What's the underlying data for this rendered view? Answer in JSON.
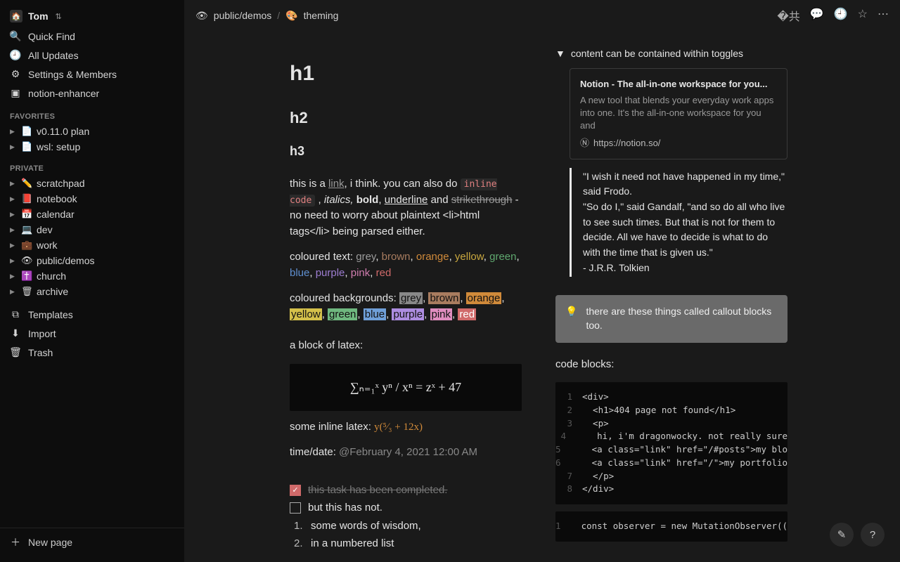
{
  "workspace": {
    "name": "Tom",
    "avatar_emoji": "🏠"
  },
  "sidebar": {
    "quick_find": "Quick Find",
    "all_updates": "All Updates",
    "settings": "Settings & Members",
    "enhancer": "notion-enhancer",
    "favorites_label": "FAVORITES",
    "favorites": [
      {
        "icon": "📄",
        "label": "v0.11.0 plan"
      },
      {
        "icon": "📄",
        "label": "wsl: setup"
      }
    ],
    "private_label": "PRIVATE",
    "private": [
      {
        "icon": "✏️",
        "label": "scratchpad"
      },
      {
        "icon": "📕",
        "label": "notebook"
      },
      {
        "icon": "📅",
        "label": "calendar"
      },
      {
        "icon": "💻",
        "label": "dev"
      },
      {
        "icon": "💼",
        "label": "work"
      },
      {
        "icon": "👁",
        "label": "public/demos"
      },
      {
        "icon": "✝️",
        "label": "church"
      },
      {
        "icon": "🗑",
        "label": "archive"
      }
    ],
    "templates": "Templates",
    "import": "Import",
    "trash": "Trash",
    "new_page": "New page"
  },
  "breadcrumb": {
    "parent_icon": "👁",
    "parent": "public/demos",
    "page_icon": "🎨",
    "page": "theming"
  },
  "headings": {
    "h1": "h1",
    "h2": "h2",
    "h3": "h3"
  },
  "richtext": {
    "p1_a": "this is a ",
    "link": "link",
    "p1_b": ", i think. you can also do ",
    "inline_code": "inline code",
    "p1_c": " , ",
    "italics": "italics,",
    "bold": "bold",
    "p1_d": ", ",
    "underline": "underline",
    "p1_e": " and ",
    "strike": "strikethrough",
    "p1_f": " - no need to worry about plaintext <li>html tags</li> being parsed either."
  },
  "coloured_text_label": "coloured text:",
  "coloured_bg_label": "coloured backgrounds:",
  "colours": [
    "grey",
    "brown",
    "orange",
    "yellow",
    "green",
    "blue",
    "purple",
    "pink",
    "red"
  ],
  "latex": {
    "block_label": "a block of latex:",
    "block_expr": "∑ₙ₌₁ˣ  yⁿ / xⁿ  =  zˣ + 47",
    "inline_label": "some inline latex: ",
    "inline_expr": "y(⁵⁄₃ + 12x)"
  },
  "timedate": {
    "label": "time/date: ",
    "value": "@February 4, 2021 12:00 AM"
  },
  "tasks": {
    "done": "this task has been completed.",
    "todo": "but this has not."
  },
  "numbered": [
    "some words of wisdom,",
    "in a numbered list"
  ],
  "toggle": {
    "label": "content can be contained within toggles"
  },
  "bookmark": {
    "title": "Notion - The all-in-one workspace for you...",
    "desc": "A new tool that blends your everyday work apps into one. It's the all-in-one workspace for you and",
    "url": "https://notion.so/"
  },
  "quote": {
    "l1": "\"I wish it need not have happened in my time,\" said Frodo.",
    "l2": "\"So do I,\" said Gandalf, \"and so do all who live to see such times. But that is not for them to decide. All we have to decide is what to do with the time that is given us.\"",
    "l3": "- J.R.R. Tolkien"
  },
  "callout": {
    "icon": "💡",
    "text": "there are these things called callout blocks too."
  },
  "code_label": "code blocks:",
  "code1": [
    "<div>",
    "  <h1>404 page not found</h1>",
    "  <p>",
    "    hi, i'm dragonwocky. not really sure",
    "    <a class=\"link\" href=\"/#posts\">my blo",
    "    <a class=\"link\" href=\"/\">my portfolio",
    "  </p>",
    "</div>"
  ],
  "code2": [
    "  const observer = new MutationObserver((li"
  ]
}
